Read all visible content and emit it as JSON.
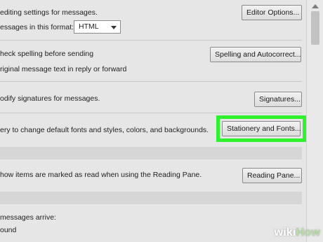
{
  "compose": {
    "editing_text": "editing settings for messages.",
    "editor_options_button": "Editor Options...",
    "format_text": "essages in this format:",
    "format_value": "HTML"
  },
  "spelling": {
    "check_spelling_text": "heck spelling before sending",
    "spelling_button": "Spelling and Autocorrect...",
    "original_message_text": "riginal message text in reply or forward"
  },
  "signatures": {
    "text": "odify signatures for messages.",
    "button": "Signatures..."
  },
  "stationery": {
    "text": "ery to change default fonts and styles, colors, and backgrounds.",
    "button": "Stationery and Fonts...",
    "highlight_color": "#2df22d"
  },
  "reading_pane": {
    "text": "how items are marked as read when using the Reading Pane.",
    "button": "Reading Pane..."
  },
  "arrival": {
    "text": "messages arrive:",
    "sound_text": "ound"
  },
  "watermark": {
    "wiki": "wiki",
    "how": "How"
  },
  "icons": {
    "dropdown": "chevron-down-icon",
    "scroll_up": "scroll-up-arrow-icon"
  }
}
